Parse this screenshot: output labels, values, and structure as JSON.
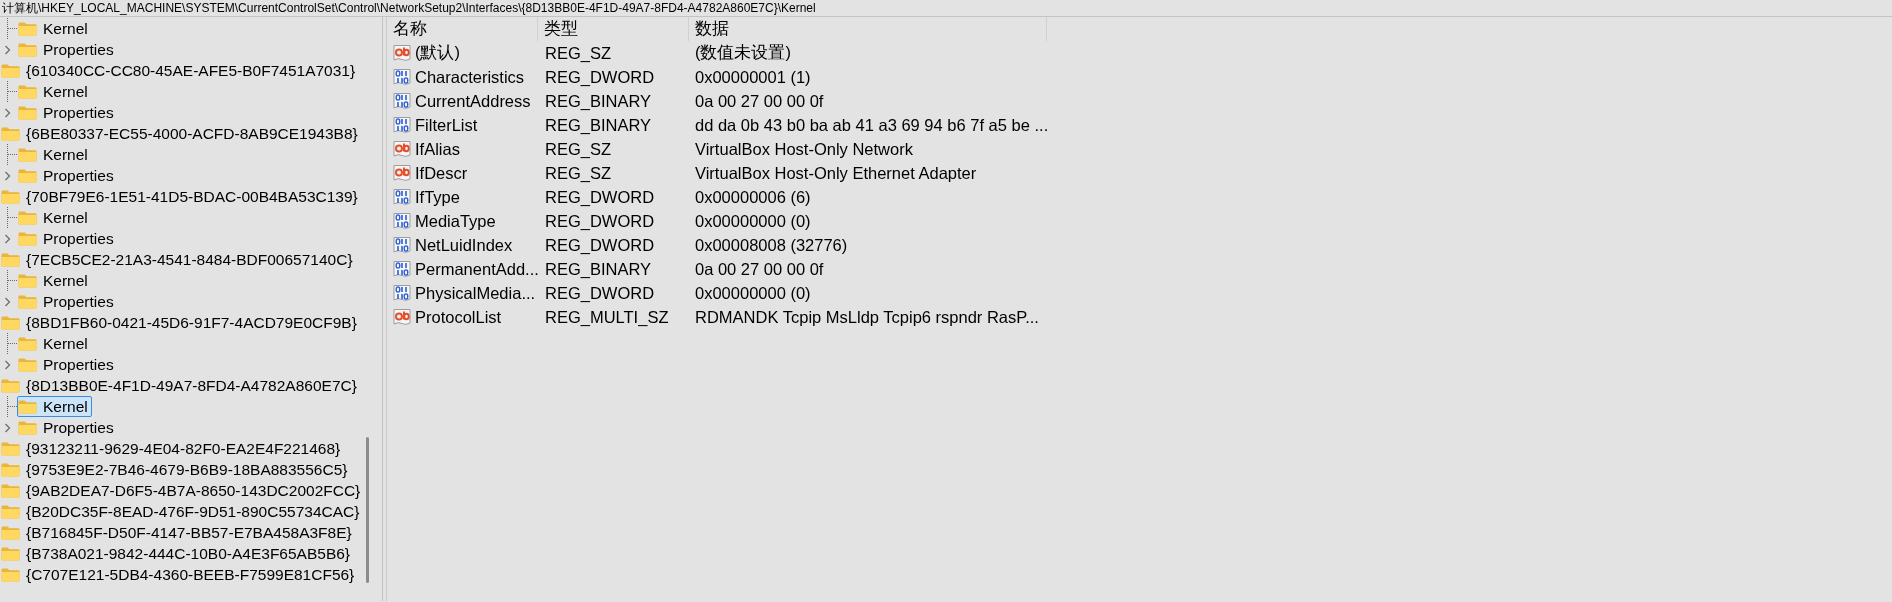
{
  "address_bar": {
    "value": "计算机\\HKEY_LOCAL_MACHINE\\SYSTEM\\CurrentControlSet\\Control\\NetworkSetup2\\Interfaces\\{8D13BB0E-4F1D-49A7-8FD4-A4782A860E7C}\\Kernel"
  },
  "tree": {
    "items": [
      {
        "children": [
          {
            "label": "Kernel",
            "expandable": false,
            "selected": false
          },
          {
            "label": "Properties",
            "expandable": true,
            "selected": false
          }
        ]
      },
      {
        "label": "{610340CC-CC80-45AE-AFE5-B0F7451A7031}",
        "selected": false,
        "children": [
          {
            "label": "Kernel",
            "expandable": false,
            "selected": false
          },
          {
            "label": "Properties",
            "expandable": true,
            "selected": false
          }
        ]
      },
      {
        "label": "{6BE80337-EC55-4000-ACFD-8AB9CE1943B8}",
        "selected": false,
        "children": [
          {
            "label": "Kernel",
            "expandable": false,
            "selected": false
          },
          {
            "label": "Properties",
            "expandable": true,
            "selected": false
          }
        ]
      },
      {
        "label": "{70BF79E6-1E51-41D5-BDAC-00B4BA53C139}",
        "selected": false,
        "children": [
          {
            "label": "Kernel",
            "expandable": false,
            "selected": false
          },
          {
            "label": "Properties",
            "expandable": true,
            "selected": false
          }
        ]
      },
      {
        "label": "{7ECB5CE2-21A3-4541-8484-BDF00657140C}",
        "selected": false,
        "children": [
          {
            "label": "Kernel",
            "expandable": false,
            "selected": false
          },
          {
            "label": "Properties",
            "expandable": true,
            "selected": false
          }
        ]
      },
      {
        "label": "{8BD1FB60-0421-45D6-91F7-4ACD79E0CF9B}",
        "selected": false,
        "children": [
          {
            "label": "Kernel",
            "expandable": false,
            "selected": false
          },
          {
            "label": "Properties",
            "expandable": true,
            "selected": false
          }
        ]
      },
      {
        "label": "{8D13BB0E-4F1D-49A7-8FD4-A4782A860E7C}",
        "selected": false,
        "children": [
          {
            "label": "Kernel",
            "expandable": false,
            "selected": true
          },
          {
            "label": "Properties",
            "expandable": true,
            "selected": false
          }
        ]
      },
      {
        "label": "{93123211-9629-4E04-82F0-EA2E4F221468}",
        "selected": false
      },
      {
        "label": "{9753E9E2-7B46-4679-B6B9-18BA883556C5}",
        "selected": false
      },
      {
        "label": "{9AB2DEA7-D6F5-4B7A-8650-143DC2002FCC}",
        "selected": false
      },
      {
        "label": "{B20DC35F-8EAD-476F-9D51-890C55734CAC}",
        "selected": false
      },
      {
        "label": "{B716845F-D50F-4147-BB57-E7BA458A3F8E}",
        "selected": false
      },
      {
        "label": "{B738A021-9842-444C-10B0-A4E3F65AB5B6}",
        "selected": false
      },
      {
        "label": "{C707E121-5DB4-4360-BEEB-F7599E81CF56}",
        "selected": false
      }
    ]
  },
  "values": {
    "columns": [
      "名称",
      "类型",
      "数据"
    ],
    "rows": [
      {
        "kind": "string",
        "name": "(默认)",
        "type": "REG_SZ",
        "data": "(数值未设置)",
        "selected": false
      },
      {
        "kind": "binary",
        "name": "Characteristics",
        "type": "REG_DWORD",
        "data": "0x00000001 (1)",
        "selected": false
      },
      {
        "kind": "binary",
        "name": "CurrentAddress",
        "type": "REG_BINARY",
        "data": "0a 00 27 00 00 0f",
        "selected": false
      },
      {
        "kind": "binary",
        "name": "FilterList",
        "type": "REG_BINARY",
        "data": "dd da 0b 43 b0 ba ab 41 a3 69 94 b6 7f a5 be ...",
        "selected": false
      },
      {
        "kind": "string",
        "name": "IfAlias",
        "type": "REG_SZ",
        "data": "VirtualBox Host-Only Network",
        "selected": false
      },
      {
        "kind": "string",
        "name": "IfDescr",
        "type": "REG_SZ",
        "data": "VirtualBox Host-Only Ethernet Adapter",
        "selected": false
      },
      {
        "kind": "binary",
        "name": "IfType",
        "type": "REG_DWORD",
        "data": "0x00000006 (6)",
        "selected": false
      },
      {
        "kind": "binary",
        "name": "MediaType",
        "type": "REG_DWORD",
        "data": "0x00000000 (0)",
        "selected": false
      },
      {
        "kind": "binary",
        "name": "NetLuidIndex",
        "type": "REG_DWORD",
        "data": "0x00008008 (32776)",
        "selected": false
      },
      {
        "kind": "binary",
        "name": "PermanentAdd...",
        "type": "REG_BINARY",
        "data": "0a 00 27 00 00 0f",
        "selected": false
      },
      {
        "kind": "binary",
        "name": "PhysicalMedia...",
        "type": "REG_DWORD",
        "data": "0x00000000 (0)",
        "selected": false
      },
      {
        "kind": "string",
        "name": "ProtocolList",
        "type": "REG_MULTI_SZ",
        "data": "RDMANDK Tcpip MsLldp Tcpip6 rspndr RasP...",
        "selected": false
      }
    ]
  }
}
